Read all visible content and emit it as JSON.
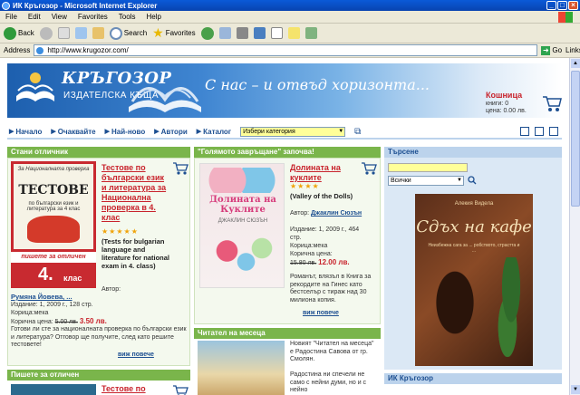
{
  "window": {
    "title": "ИК Кръгозор - Microsoft Internet Explorer",
    "min": "_",
    "max": "□",
    "close": "×"
  },
  "menu": [
    "File",
    "Edit",
    "View",
    "Favorites",
    "Tools",
    "Help"
  ],
  "toolbar": {
    "back": "Back",
    "search": "Search",
    "favorites": "Favorites"
  },
  "address": {
    "label": "Address",
    "url": "http://www.krugozor.com/",
    "go": "Go",
    "links": "Links"
  },
  "site": {
    "logo_name": "КРЪГОЗОР",
    "logo_sub": "ИЗДАТЕЛСКА КЪЩА",
    "slogan": "С нас – и отвъд хоризонта...",
    "cart": {
      "title": "Кошница",
      "books": "книги: 0",
      "price": "цена: 0.00 лв."
    }
  },
  "nav": {
    "items": [
      "Начало",
      "Очаквайте",
      "Най-ново",
      "Автори",
      "Каталог"
    ],
    "category_select": "Избери категория"
  },
  "col1": {
    "header": "Стани отличник",
    "cover_top": "За Националната проверка",
    "cover_title": "ТЕСТОВЕ",
    "cover_lines": "по български език и литература за 4 клас",
    "cover_banner": "пишете за отличен",
    "cover_grade": "4.",
    "cover_grade_word": "клас",
    "book_title": "Тестове по български език и литература за Национална проверка в 4. клас",
    "stars": "★★★★★",
    "en_title": "(Tests for bulgarian language and literature for national exam in 4. class)",
    "author_label": "Автор:",
    "author": "Румяна Йовева, ...",
    "edition": "Издание: 1, 2009 г., 128 стр.",
    "cover_type": "Корица:мека",
    "price_label": "Коричнa цена:",
    "old_price": "5.00 лв.",
    "new_price": "3.50 лв.",
    "desc": "Готови ли сте за националната проверка по български език и литература? Отговор ще получите, след като решите тестовете!",
    "more": "виж повече",
    "header2": "Пишете за отличен",
    "book2_title": "Тестове по"
  },
  "col2": {
    "header": "\"Голямото завръщане\" започва!",
    "cover_title": "Долината на Куклите",
    "cover_author": "ДЖАКЛИН СЮЗЪН",
    "book_title": "Долината на куклите",
    "stars": "★★★★",
    "en_title": "(Valley of the Dolls)",
    "author_label": "Автор:",
    "author": "Джаклин Сюзън",
    "edition": "Издание: 1, 2009 г., 464 стр.",
    "cover_type": "Корица:мека",
    "price_label": "Коричнa цена:",
    "old_price": "15.80 лв.",
    "new_price": "12.00 лв.",
    "desc": "Романът, влязъл в Книга за рекордите на Гинес като бестселър с тираж над 30 милиона копия.",
    "more": "виж повече",
    "header2": "Читател на месеца",
    "reader_text": "Новият \"Читател на месеца\" е Радостина Савова от гр. Смолян.",
    "reader_text2": "Радостина ни спечели не само с нейни думи, но и с нейно"
  },
  "col3": {
    "search_header": "Търсене",
    "search_select": "Всички",
    "promo_author": "Алекия Видела",
    "promo_title": "Cдъх на кафе",
    "promo_blurb": "Неизбежна сага за ... робството, страстта и ...",
    "header2": "ИК Кръгозор"
  },
  "colors": {
    "green_head": "#7ab54b",
    "blue_head": "#bcd3ec",
    "red_link": "#c8232c",
    "nav_blue": "#1d4f91",
    "yellow_input": "#ffff99"
  }
}
